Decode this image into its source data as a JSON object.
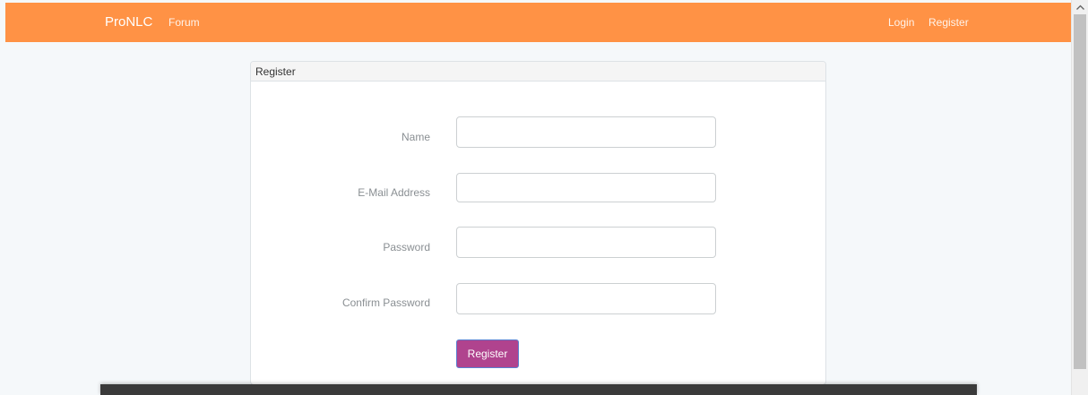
{
  "navbar": {
    "brand": "ProNLC",
    "forum": "Forum",
    "login": "Login",
    "register": "Register",
    "bg_color": "#ff9245"
  },
  "panel": {
    "title": "Register"
  },
  "form": {
    "name_label": "Name",
    "name_value": "",
    "email_label": "E-Mail Address",
    "email_value": "",
    "password_label": "Password",
    "password_value": "",
    "confirm_label": "Confirm Password",
    "confirm_value": "",
    "submit_label": "Register",
    "button_color": "#b0438e"
  },
  "scrollbar": {
    "up_icon": "chevron-up-icon"
  }
}
